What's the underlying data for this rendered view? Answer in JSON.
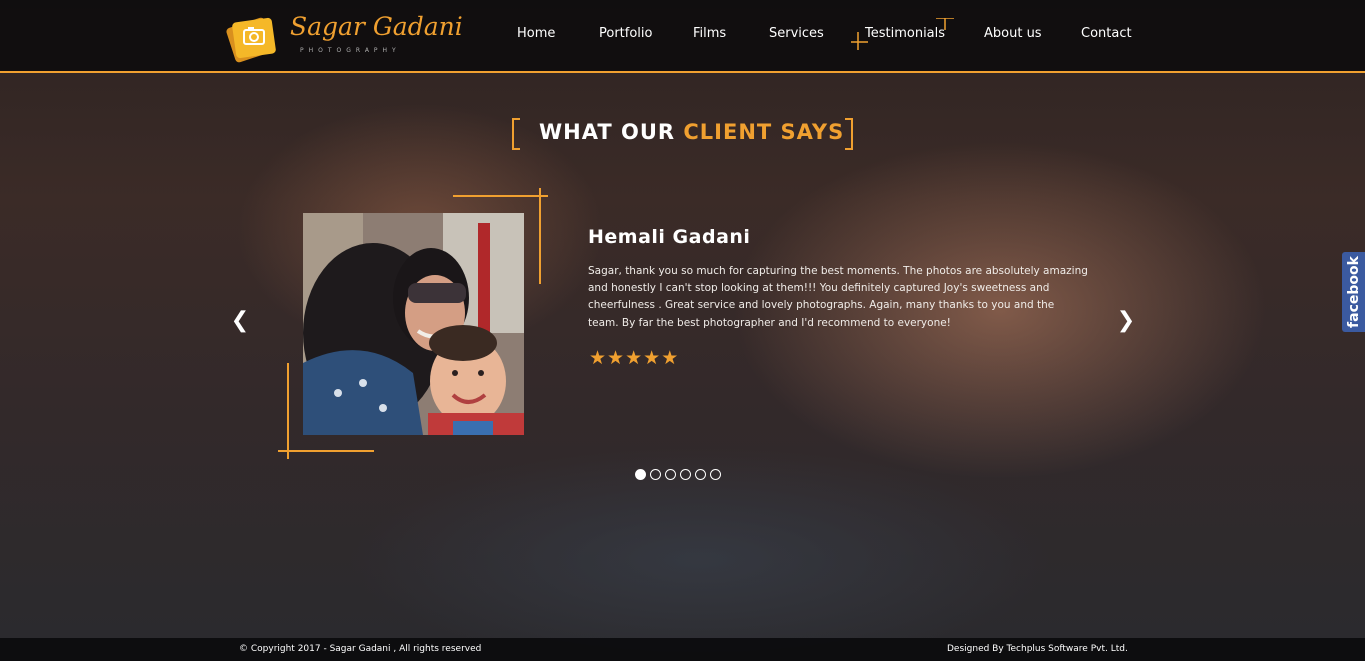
{
  "brand": {
    "name": "Sagar Gadani",
    "tagline": "PHOTOGRAPHY"
  },
  "nav": {
    "items": [
      {
        "label": "Home"
      },
      {
        "label": "Portfolio"
      },
      {
        "label": "Films"
      },
      {
        "label": "Services"
      },
      {
        "label": "Testimonials"
      },
      {
        "label": "About us"
      },
      {
        "label": "Contact"
      }
    ],
    "active": "Testimonials"
  },
  "section": {
    "title_prefix": "WHAT OUR ",
    "title_accent": "CLIENT SAYS"
  },
  "testimonial": {
    "name": "Hemali Gadani",
    "text": "Sagar, thank you so much for capturing the best moments. The photos are absolutely amazing and honestly I can't stop looking at them!!! You definitely captured Joy's sweetness and cheerfulness . Great service and lovely photographs. Again, many thanks to you and the team. By far the best photographer and I'd recommend to everyone!",
    "rating": 5,
    "star_glyph": "★",
    "photo_icon": "client-photo"
  },
  "carousel": {
    "prev_glyph": "❮",
    "next_glyph": "❯",
    "slide_count": 6,
    "active_index": 0
  },
  "social": {
    "facebook_label": "facebook"
  },
  "footer": {
    "copyright": "© Copyright 2017 - Sagar Gadani , All rights reserved",
    "designer": "Designed By Techplus Software Pvt. Ltd."
  },
  "colors": {
    "accent": "#f0a030",
    "facebook": "#3b5aa0",
    "header_bg": "#0c0a0c"
  }
}
